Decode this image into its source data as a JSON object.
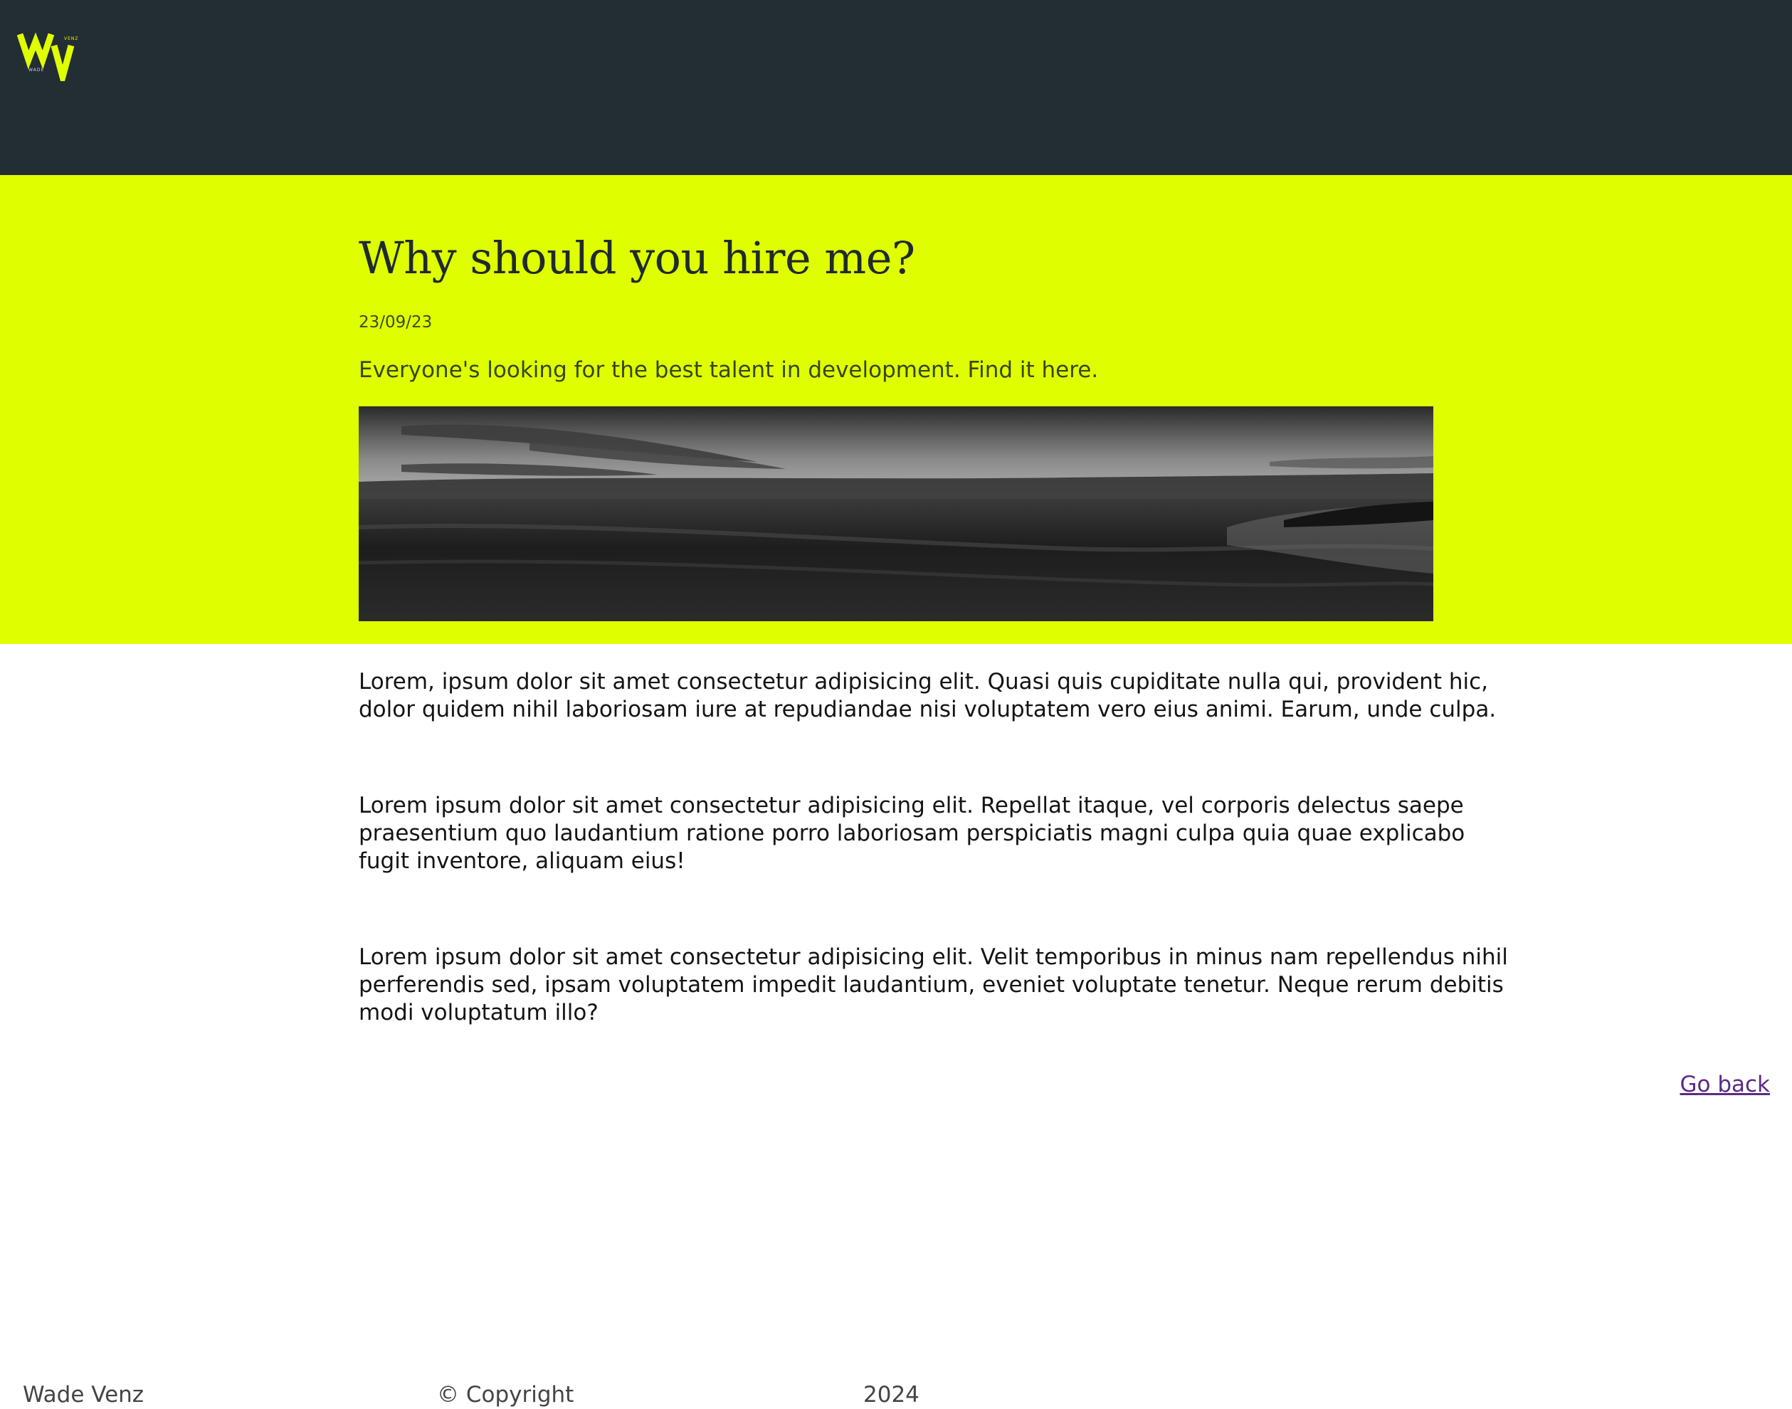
{
  "logo": {
    "alt": "Wade Venz logo",
    "small_top": "VENZ",
    "small_bottom": "WADE",
    "accent": "#dfff00"
  },
  "header": {
    "background": "#232d34"
  },
  "hero": {
    "background": "#dfff00",
    "title": "Why should you hire me?",
    "date": "23/09/23",
    "subtitle": "Everyone's looking for the best talent in development. Find it here.",
    "image_alt": "Black and white photo of a beach at dusk"
  },
  "article": {
    "paragraphs": [
      "Lorem, ipsum dolor sit amet consectetur adipisicing elit. Quasi quis cupiditate nulla qui, provident hic, dolor quidem nihil laboriosam iure at repudiandae nisi voluptatem vero eius animi. Earum, unde culpa.",
      "Lorem ipsum dolor sit amet consectetur adipisicing elit. Repellat itaque, vel corporis delectus saepe praesentium quo laudantium ratione porro laboriosam perspiciatis magni culpa quia quae explicabo fugit inventore, aliquam eius!",
      "Lorem ipsum dolor sit amet consectetur adipisicing elit. Velit temporibus in minus nam repellendus nihil perferendis sed, ipsam voluptatem impedit laudantium, eveniet voluptate tenetur. Neque rerum debitis modi voluptatum illo?"
    ]
  },
  "nav": {
    "go_back": "Go back"
  },
  "footer": {
    "name": "Wade Venz",
    "copyright": "© Copyright",
    "year": "2024"
  }
}
